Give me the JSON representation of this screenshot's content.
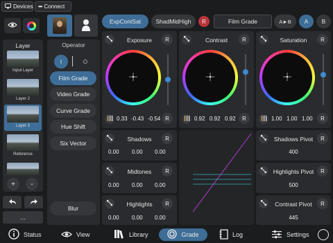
{
  "topbar": {
    "devices_label": "Devices",
    "connect_label": "Connect"
  },
  "sidebar": {
    "layer_title": "Layer",
    "layers": [
      {
        "label": "Input Layer"
      },
      {
        "label": "Layer 2"
      },
      {
        "label": "Layer 3",
        "selected": true
      },
      {
        "label": "Reference"
      },
      {
        "label": ""
      }
    ],
    "add_label": "+",
    "remove_label": "-",
    "more_label": "..."
  },
  "operator": {
    "title": "Operator",
    "toggle_on": "I",
    "toggle_off": "O",
    "items": [
      "Film Grade",
      "Video Grade",
      "Curve Grade",
      "Hue Shift",
      "Six Vector"
    ],
    "active": "Film Grade",
    "blur_label": "Blur"
  },
  "tabs": {
    "tab1": "ExpContSat",
    "tab2": "ShadMidHigh",
    "reset": "R",
    "grade_title": "Film Grade",
    "ab_label": "A►B",
    "a_label": "A",
    "b_label": "B"
  },
  "wheels": [
    {
      "title": "Exposure",
      "reset": "R",
      "values": [
        "0.33",
        "-0.43",
        "-0.54"
      ],
      "slider_level": 0.5
    },
    {
      "title": "Contrast",
      "reset": "R",
      "values": [
        "0.92",
        "0.92",
        "0.92"
      ],
      "slider_level": 0.35
    },
    {
      "title": "Saturation",
      "reset": "R",
      "values": [
        "1.00",
        "1.00",
        "1.00"
      ],
      "slider_level": 0.4
    }
  ],
  "tone_rows": [
    {
      "title": "Shadows",
      "reset": "R",
      "values": [
        "0.00",
        "0.00",
        "0.00"
      ]
    },
    {
      "title": "Midtones",
      "reset": "R",
      "values": [
        "0.00",
        "0.00",
        "0.00"
      ]
    },
    {
      "title": "Highlights",
      "reset": "R",
      "values": [
        "0.00",
        "0.00",
        "0.00"
      ]
    }
  ],
  "pivots": [
    {
      "title": "Shadows Pivot",
      "reset": "R",
      "value": "400"
    },
    {
      "title": "Highlights Pivot",
      "reset": "R",
      "value": "500"
    },
    {
      "title": "Contrast Pivot",
      "reset": "R",
      "value": "445"
    }
  ],
  "bottombar": {
    "status_label": "Status",
    "view_label": "View",
    "library_label": "Library",
    "grade_label": "Grade",
    "log_label": "Log",
    "settings_label": "Settings"
  },
  "colors": {
    "accent": "#3e6e97",
    "panel": "#2a2b2e",
    "reset_red": "#b8343a",
    "curve_magenta": "#b43bd6",
    "curve_cyan": "#3bb0c0"
  }
}
